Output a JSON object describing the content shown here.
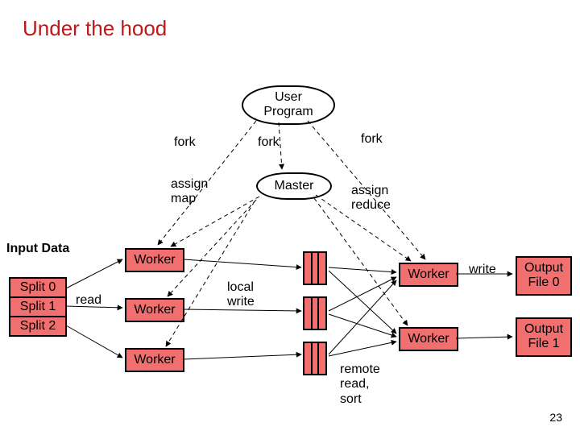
{
  "title": "Under the hood",
  "nodes": {
    "user_program": "User\nProgram",
    "master": "Master",
    "worker": "Worker",
    "split0": "Split 0",
    "split1": "Split 1",
    "split2": "Split 2",
    "out0": "Output\nFile 0",
    "out1": "Output\nFile 1"
  },
  "labels": {
    "input_data": "Input Data",
    "fork_l": "fork",
    "fork_m": "fork",
    "fork_r": "fork",
    "assign_map": "assign\nmap",
    "assign_reduce": "assign\nreduce",
    "read": "read",
    "local_write": "local\nwrite",
    "write": "write",
    "remote_read_sort": "remote\nread,\nsort"
  },
  "page_number": "23"
}
